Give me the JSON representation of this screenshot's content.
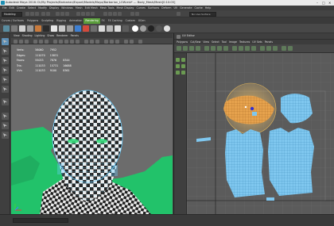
{
  "window": {
    "title": "Autodesk Maya 2016: D:/My Projects/Barbarian/Export/Models/Maya/Barbarian_LOW.mb*   ---   Body_Mesh/Mesh[0:10:05]",
    "controls": [
      "–",
      "□",
      "✕"
    ]
  },
  "main_menu": [
    "File",
    "Edit",
    "Create",
    "Select",
    "Modify",
    "Display",
    "Windows",
    "Mesh",
    "Edit Mesh",
    "Mesh Tools",
    "Mesh Display",
    "Curves",
    "Surfaces",
    "Deform",
    "UV",
    "Generate",
    "Cache",
    "Help"
  ],
  "status_line": {
    "mode": "Modeling",
    "live_surface": "No Live Surface"
  },
  "shelf_tabs": [
    {
      "label": "Curves / Surfaces",
      "state": "normal"
    },
    {
      "label": "Polygons",
      "state": "normal"
    },
    {
      "label": "Sculpting",
      "state": "normal"
    },
    {
      "label": "Rigging",
      "state": "normal"
    },
    {
      "label": "Animation",
      "state": "normal"
    },
    {
      "label": "Rendering",
      "state": "sel"
    },
    {
      "label": "FX",
      "state": "normal"
    },
    {
      "label": "FX Caching",
      "state": "normal"
    },
    {
      "label": "Custom",
      "state": "normal"
    },
    {
      "label": "XGen",
      "state": "normal"
    }
  ],
  "viewport": {
    "menu": [
      "View",
      "Shading",
      "Lighting",
      "Show",
      "Renderer",
      "Panels"
    ],
    "hud": [
      {
        "label": "Verts:",
        "v1": "56060",
        "v2": "7952",
        "v3": ""
      },
      {
        "label": "Edges:",
        "v1": "111070",
        "v2": "15831",
        "v3": ""
      },
      {
        "label": "Faces:",
        "v1": "55033",
        "v2": "7876",
        "v3": "8344"
      },
      {
        "label": "Tris:",
        "v1": "111033",
        "v2": "15731",
        "v3": "16688"
      },
      {
        "label": "UVs:",
        "v1": "111033",
        "v2": "9100",
        "v3": "8361"
      }
    ]
  },
  "uv_editor": {
    "title": "UV Editor",
    "menu": [
      "Polygons",
      "Cut/Sew",
      "View",
      "Select",
      "Tool",
      "Image",
      "Textures",
      "UV Sets",
      "Panels"
    ]
  },
  "colors": {
    "accent_green": "#5a9d3b",
    "uv_shell_blue": "#7fc7ef",
    "uv_shell_selected": "#e6a24d",
    "soft_select_gradient": "#f2c36b",
    "viewport_bg": "#6c6c6c",
    "mesh_green": "#22c26a"
  },
  "icons": {
    "toolbox": [
      "select-tool-icon",
      "lasso-tool-icon",
      "paint-select-icon",
      "move-tool-icon",
      "rotate-tool-icon",
      "scale-tool-icon",
      "last-tool-icon",
      "layout-single-icon",
      "layout-quad-icon",
      "layout-split-icon"
    ],
    "uv_side": [
      "uv-select-icon",
      "uv-move-icon",
      "uv-rotate-icon",
      "uv-scale-icon",
      "uv-smudge-icon",
      "uv-pin-icon"
    ]
  }
}
